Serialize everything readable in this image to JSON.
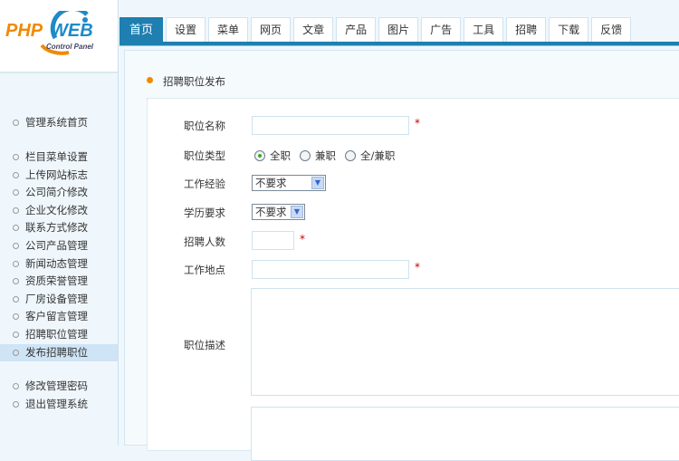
{
  "logo": {
    "text": "PHPWEB",
    "subtitle": "Control Panel"
  },
  "tabs": [
    "首页",
    "设置",
    "菜单",
    "网页",
    "文章",
    "产品",
    "图片",
    "广告",
    "工具",
    "招聘",
    "下载",
    "反馈"
  ],
  "sidebar": {
    "items": [
      "管理系统首页",
      "栏目菜单设置",
      "上传网站标志",
      "公司简介修改",
      "企业文化修改",
      "联系方式修改",
      "公司产品管理",
      "新闻动态管理",
      "资质荣誉管理",
      "厂房设备管理",
      "客户留言管理",
      "招聘职位管理",
      "发布招聘职位",
      "修改管理密码",
      "退出管理系统"
    ]
  },
  "page_title": "招聘职位发布",
  "form": {
    "job_name": {
      "label": "职位名称",
      "value": ""
    },
    "job_type": {
      "label": "职位类型",
      "options": [
        "全职",
        "兼职",
        "全/兼职"
      ],
      "selected": "全职"
    },
    "experience": {
      "label": "工作经验",
      "value": "不要求"
    },
    "education": {
      "label": "学历要求",
      "value": "不要求"
    },
    "headcount": {
      "label": "招聘人数",
      "value": ""
    },
    "location": {
      "label": "工作地点",
      "value": ""
    },
    "description": {
      "label": "职位描述",
      "value": ""
    },
    "required_mark": "*"
  }
}
